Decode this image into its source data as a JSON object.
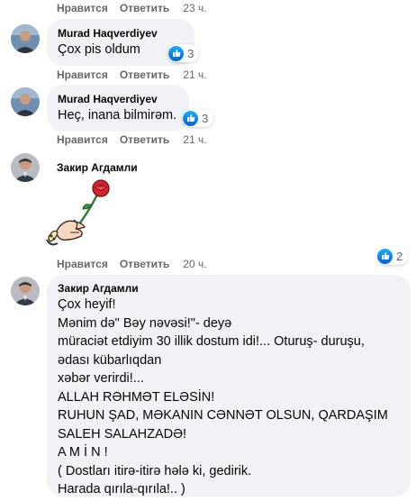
{
  "action_labels": {
    "like": "Нравится",
    "reply": "Ответить"
  },
  "top_actions": {
    "time": "23 ч."
  },
  "comments": [
    {
      "author": "Murad Haqverdiyev",
      "text": "Çox pis oldum",
      "reactions": "3",
      "time": "21 ч."
    },
    {
      "author": "Murad Haqverdiyev",
      "text": "Heç, inana bilmirəm.",
      "reactions": "3",
      "time": "21 ч."
    },
    {
      "author": "Закир Агдамли",
      "sticker": "rose-in-hand-sticker",
      "reactions": "2",
      "time": "20 ч."
    },
    {
      "author": "Закир Агдамли",
      "text": "Çox heyif!\nMənim də\" Bəy nəvəsi!\"- deyə\nmüraciət etdiyim 30 illik dostum idi!... Oturuş- duruşu,\nədası kübarlıqdan\nxəbər verirdi!...\nALLAH RƏHMƏT ELƏSİN!\nRUHUN ŞAD, MƏKANIN CƏNNƏT OLSUN, QARDAŞIM\nSALEH SALAHZADƏ!\nA M İ N !\n( Dostları itirə-itirə hələ ki, gedirik.\nHarada qırıla-qırıla!.. )"
    }
  ],
  "colors": {
    "bubble": "#f0f2f5",
    "meta": "#65676b",
    "like_blue": "#1877f2"
  }
}
